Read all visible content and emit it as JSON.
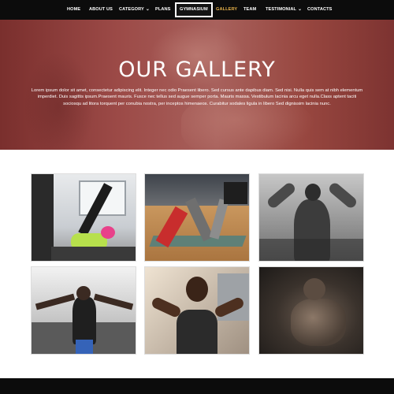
{
  "nav": {
    "items": [
      {
        "label": "HOME"
      },
      {
        "label": "ABOUT US"
      },
      {
        "label": "CATEGORY",
        "dropdown": true
      },
      {
        "label": "PLANS"
      },
      {
        "label": "GYMNASIUM",
        "state": "active"
      },
      {
        "label": "GALLERY",
        "state": "highlight"
      },
      {
        "label": "TEAM"
      },
      {
        "label": "TESTIMONIAL",
        "dropdown": true
      },
      {
        "label": "CONTACTS"
      }
    ],
    "highlight_color": "#e8b34a",
    "chevron_icon": "chevron-down-icon"
  },
  "hero": {
    "title": "OUR GALLERY",
    "text": "Lorem ipsum dolor sit amet, consectetur adipiscing elit. Integer nec odio Praesent libero. Sed cursus ante dapibus diam. Sed nisi. Nulla quis sem at nibh elementum imperdiet. Duis sagittis ipsum.Praesent mauris. Fusce nec tellus sed augue semper porta. Mauris massa. Vestibulum lacinia arcu eget nulla.Class aptent taciti sociosqu ad litora torquent per conubia nostra, per inceptos himenaeos. Curabitur sodales ligula in libero Sed dignissim lacinia nunc.",
    "overlay_color": "#9c4a47"
  },
  "gallery": {
    "images": [
      {
        "name": "stretching-class-photo"
      },
      {
        "name": "yoga-class-photo"
      },
      {
        "name": "bodybuilder-bw-photo"
      },
      {
        "name": "cable-crossover-photo"
      },
      {
        "name": "woman-flexing-photo"
      },
      {
        "name": "muscular-torso-dark-photo"
      }
    ]
  }
}
